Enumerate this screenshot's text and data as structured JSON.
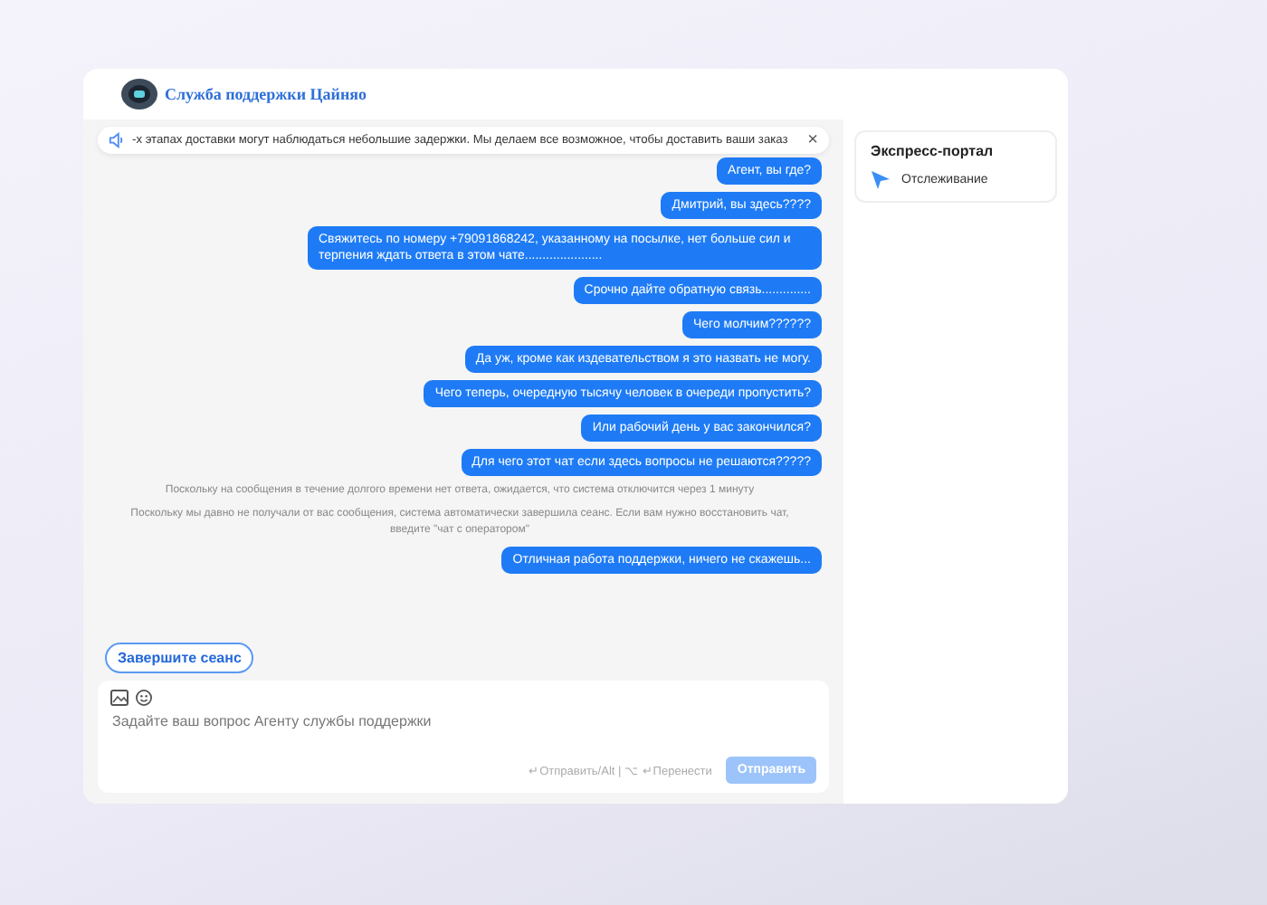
{
  "header": {
    "title": "Служба поддержки Цайняо"
  },
  "notice": {
    "text": "-х этапах доставки могут наблюдаться небольшие задержки. Мы делаем все возможное, чтобы доставить ваши заказ",
    "close": "×"
  },
  "messages": [
    {
      "kind": "user",
      "text": "Агент, вы где?"
    },
    {
      "kind": "user",
      "text": "Дмитрий, вы здесь????"
    },
    {
      "kind": "user",
      "text": "Свяжитесь по номеру +79091868242, указанному на посылке, нет больше сил и терпения ждать ответа в этом чате......................"
    },
    {
      "kind": "user",
      "text": "Срочно дайте обратную связь.............."
    },
    {
      "kind": "user",
      "text": "Чего молчим??????"
    },
    {
      "kind": "user",
      "text": "Да уж, кроме как издевательством я это назвать не могу."
    },
    {
      "kind": "user",
      "text": "Чего теперь, очередную тысячу человек в очереди пропустить?"
    },
    {
      "kind": "user",
      "text": "Или рабочий день у вас закончился?"
    },
    {
      "kind": "user",
      "text": "Для чего этот чат если здесь вопросы не решаются?????"
    },
    {
      "kind": "system",
      "text": "Поскольку на сообщения в течение долгого времени нет ответа, ожидается, что система отключится через 1 минуту"
    },
    {
      "kind": "system",
      "text": "Поскольку мы давно не получали от вас сообщения, система автоматически завершила сеанс. Если вам нужно восстановить чат, введите \"чат с оператором\""
    },
    {
      "kind": "user",
      "text": "Отличная работа поддержки, ничего не скажешь..."
    }
  ],
  "end_session_button": "Завершите сеанс",
  "composer": {
    "placeholder": "Задайте ваш вопрос Агенту службы поддержки",
    "hint": "↵Отправить/Alt | ⌥ ↵Перенести",
    "send_button": {
      "label": "Отправить",
      "disabled": true
    }
  },
  "sidebar": {
    "title": "Экспресс-портал",
    "items": [
      {
        "label": "Отслеживание"
      }
    ]
  }
}
